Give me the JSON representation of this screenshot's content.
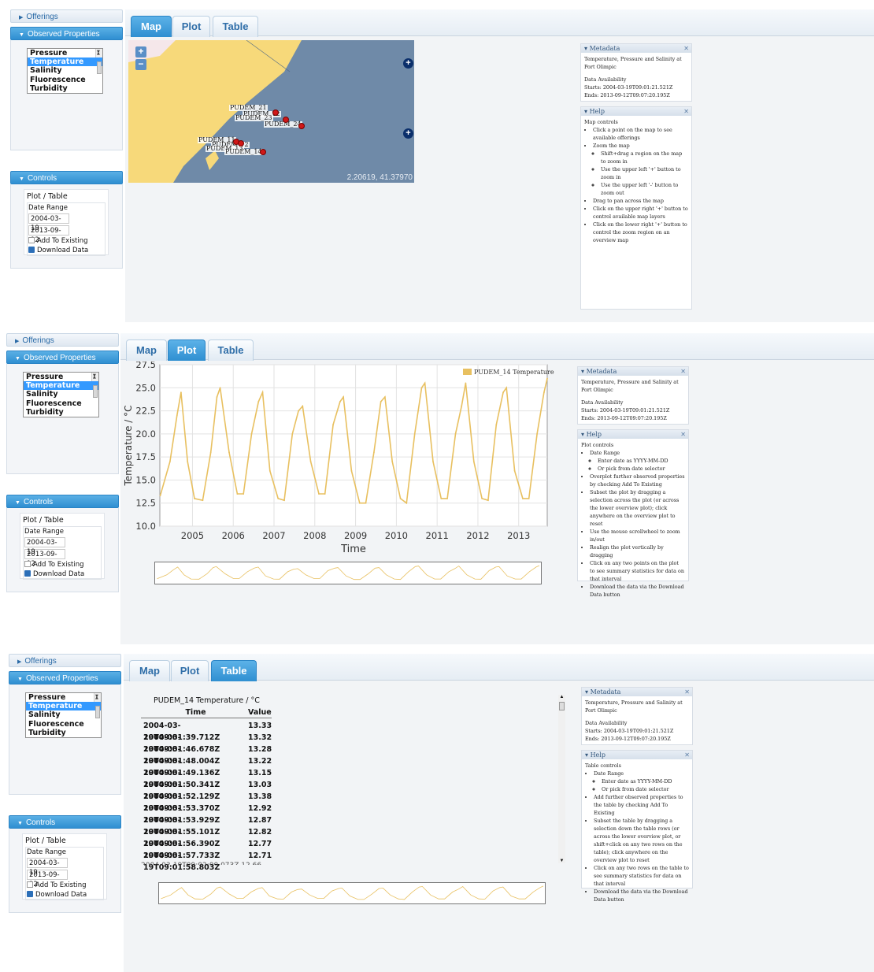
{
  "sidebar": {
    "offerings_label": "Offerings",
    "observed_label": "Observed Properties",
    "properties": [
      "Pressure",
      "Temperature",
      "Salinity",
      "Fluorescence",
      "Turbidity"
    ],
    "selected_property": "Temperature",
    "controls_label": "Controls",
    "plot_table_label": "Plot / Table",
    "date_range_label": "Date Range",
    "start_date": "2004-03-19",
    "end_date": "2013-09-12",
    "add_existing_label": "Add To Existing",
    "download_label": "Download Data"
  },
  "tabs": {
    "map": "Map",
    "plot": "Plot",
    "table": "Table"
  },
  "metadata": {
    "title": "Metadata",
    "description": "Temperature, Pressure and Salinity at Port Olimpic",
    "availability": "Data Availability",
    "starts": "Starts: 2004-03-19T09:01:21.521Z",
    "ends": "Ends: 2013-09-12T09:07:20.195Z"
  },
  "help_title": "Help",
  "map_help": {
    "heading": "Map controls",
    "items": [
      {
        "text": "Click a point on the map to see available offerings"
      },
      {
        "text": "Zoom the map",
        "sub": [
          "Shift+drag a region on the map to zoom in",
          "Use the upper left '+' button to zoom in",
          "Use the upper left '-' button to zoom out"
        ]
      },
      {
        "text": "Drag to pan across the map"
      },
      {
        "text": "Click on the upper right '+' button to control available map layers"
      },
      {
        "text": "Click on the lower right '+' button to control the zoom region on an overview map"
      }
    ]
  },
  "plot_help": {
    "heading": "Plot controls",
    "items": [
      {
        "text": "Date Range",
        "sub": [
          "Enter date as YYYY-MM-DD",
          "Or pick from date selector"
        ]
      },
      {
        "text": "Overplot further observed properties by checking Add To Existing"
      },
      {
        "text": "Subset the plot by dragging a selection across the plot (or across the lower overview plot); click anywhere on the overview plot to reset"
      },
      {
        "text": "Use the mouse scrollwheel to zoom in/out"
      },
      {
        "text": "Realign the plot vertically by dragging"
      },
      {
        "text": "Click on any two points on the plot to see summary statistics for data on that interval"
      },
      {
        "text": "Download the data via the Download Data button"
      }
    ]
  },
  "table_help": {
    "heading": "Table controls",
    "items": [
      {
        "text": "Date Range",
        "sub": [
          "Enter date as YYYY-MM-DD",
          "Or pick from date selector"
        ]
      },
      {
        "text": "Add further observed properties to the table by checking Add To Existing"
      },
      {
        "text": "Subset the table by dragging a selection down the table rows (or across the lower overview plot, or shift+click on any two rows on the table); click anywhere on the overview plot to reset"
      },
      {
        "text": "Click on any two rows on the table to see summary statistics for data on that interval"
      },
      {
        "text": "Download the data via the Download Data button"
      }
    ]
  },
  "map": {
    "zoom_in": "+",
    "zoom_out": "−",
    "coords": "2.20619, 41.37970",
    "labels": [
      "PUDEM_21",
      "PUDEM_22",
      "PUDEM_23",
      "PUDEM_24",
      "PUDEM_11",
      "PUDEM_12",
      "PUDEM_13",
      "PUDEM_14"
    ]
  },
  "chart_data": {
    "type": "line",
    "title": "",
    "xlabel": "Time",
    "ylabel": "Temperature / °C",
    "legend": "PUDEM_14 Temperature",
    "legend_position": "top-right",
    "color": "#e8c060",
    "grid": true,
    "ylim": [
      10.0,
      27.5
    ],
    "yticks": [
      "10.0",
      "12.5",
      "15.0",
      "17.5",
      "20.0",
      "22.5",
      "25.0",
      "27.5"
    ],
    "xticks": [
      "2005",
      "2006",
      "2007",
      "2008",
      "2009",
      "2010",
      "2011",
      "2012",
      "2013"
    ],
    "x": [
      2004.21,
      2004.45,
      2004.62,
      2004.72,
      2004.88,
      2005.05,
      2005.25,
      2005.45,
      2005.6,
      2005.68,
      2005.9,
      2006.1,
      2006.25,
      2006.45,
      2006.62,
      2006.72,
      2006.9,
      2007.1,
      2007.25,
      2007.45,
      2007.6,
      2007.7,
      2007.9,
      2008.1,
      2008.25,
      2008.45,
      2008.62,
      2008.7,
      2008.9,
      2009.1,
      2009.25,
      2009.45,
      2009.62,
      2009.72,
      2009.9,
      2010.1,
      2010.25,
      2010.45,
      2010.62,
      2010.7,
      2010.9,
      2011.1,
      2011.25,
      2011.45,
      2011.6,
      2011.7,
      2011.9,
      2012.1,
      2012.25,
      2012.45,
      2012.62,
      2012.7,
      2012.9,
      2013.1,
      2013.25,
      2013.45,
      2013.62,
      2013.7
    ],
    "y": [
      13.3,
      17,
      22,
      24.5,
      17,
      13,
      12.8,
      18,
      24,
      25,
      18,
      13.5,
      13.5,
      20,
      23.5,
      24.5,
      16,
      13,
      12.8,
      20,
      22.5,
      23,
      17,
      13.5,
      13.5,
      21,
      23.5,
      24,
      16,
      12.5,
      12.5,
      18,
      23.5,
      24,
      17,
      13,
      12.5,
      20,
      25,
      25.5,
      17,
      13,
      13,
      20,
      23,
      25.5,
      17,
      13,
      12.8,
      21,
      24.5,
      25,
      16,
      13,
      13,
      20,
      24.5,
      26
    ]
  },
  "table": {
    "caption": "PUDEM_14 Temperature / °C",
    "col_time": "Time",
    "col_value": "Value",
    "rows": [
      [
        "2004-03-19T09:01:39.712Z",
        "13.33"
      ],
      [
        "2004-03-19T09:01:46.678Z",
        "13.32"
      ],
      [
        "2004-03-19T09:01:48.004Z",
        "13.28"
      ],
      [
        "2004-03-19T09:01:49.136Z",
        "13.22"
      ],
      [
        "2004-03-19T09:01:50.341Z",
        "13.15"
      ],
      [
        "2004-03-19T09:01:52.129Z",
        "13.03"
      ],
      [
        "2004-03-19T09:01:53.370Z",
        "13.38"
      ],
      [
        "2004-03-19T09:01:53.929Z",
        "12.92"
      ],
      [
        "2004-03-19T09:01:55.101Z",
        "12.87"
      ],
      [
        "2004-03-19T09:01:56.390Z",
        "12.82"
      ],
      [
        "2004-03-19T09:01:57.733Z",
        "12.77"
      ],
      [
        "2004-03-19T09:01:58.803Z",
        "12.71"
      ]
    ]
  }
}
